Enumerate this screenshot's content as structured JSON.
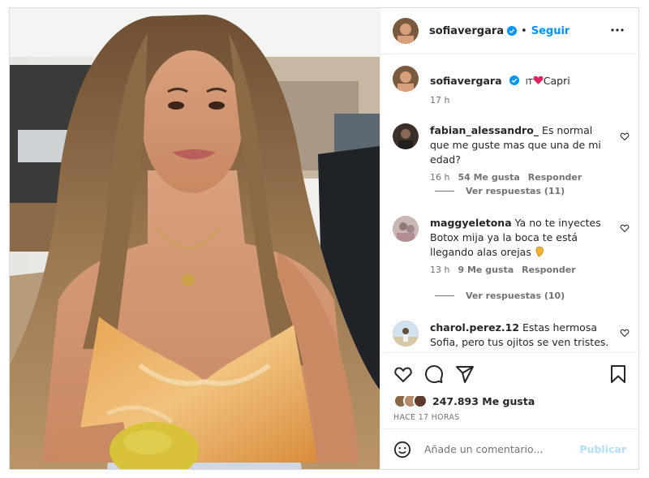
{
  "post": {
    "username": "sofiavergara",
    "follow_label": "Seguir",
    "dot": "•",
    "caption": {
      "username": "sofiavergara",
      "text_prefix": "IT",
      "text_suffix": "Capri",
      "time": "17 h"
    },
    "comments": [
      {
        "username": "fabian_alessandro_",
        "text": "Es normal que me guste mas que una de mi edad?",
        "time": "16 h",
        "likes": "54 Me gusta",
        "reply": "Responder",
        "view_replies": "Ver respuestas (11)"
      },
      {
        "username": "maggyeletona",
        "text": "Ya no te inyectes Botox mija ya la boca te está llegando alas orejas",
        "time": "13 h",
        "likes": "9 Me gusta",
        "reply": "Responder",
        "view_replies": "Ver respuestas (10)"
      },
      {
        "username": "charol.perez.12",
        "text": "Estas hermosa Sofia, pero tus ojitos se ven tristes. No dejes que nada , ni nadie opaque tu"
      }
    ],
    "likes_count": "247.893 Me gusta",
    "posted_time": "HACE 17 HORAS",
    "add_comment_placeholder": "Añade un comentario...",
    "publish_label": "Publicar"
  },
  "icons": {
    "verified": "verified-badge-icon",
    "more": "more-options-icon",
    "like": "heart-icon",
    "comment": "comment-icon",
    "share": "share-icon",
    "save": "bookmark-icon",
    "emoji": "emoji-icon"
  },
  "colors": {
    "accent": "#0095f6",
    "verified": "#0095f6",
    "publish_disabled": "#b2dffc",
    "secondary_text": "#737373"
  }
}
